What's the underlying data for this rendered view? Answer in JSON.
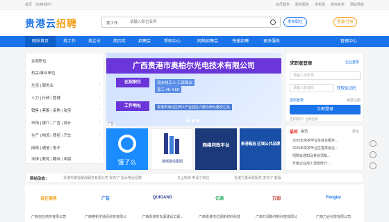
{
  "topbar": {
    "home": "首页",
    "mobile": "[切换城市]",
    "links": [
      "会员服务",
      "政务服务",
      "手机版",
      "微信有奖",
      "网站导航"
    ]
  },
  "header": {
    "logo_main": "贵港云",
    "logo_accent": "招聘",
    "search_type": "找工作",
    "search_placeholder": "请输入职位名称",
    "post_job": "发布职位",
    "login_register": "登录/注册"
  },
  "nav": {
    "items": [
      "网站首页",
      "找工作",
      "找企业",
      "简历库",
      "招聘会",
      "帮助中心",
      "网络招聘会",
      "快速招聘",
      "更多服务"
    ],
    "manage": "管理中心"
  },
  "categories": {
    "heading": "全部职位",
    "items": [
      "机关/事业单位",
      "生活 | 服务业",
      "人力 | 行政 | 管理",
      "销售 | 客服 | 采购 | 淘宝",
      "市场 | 媒介 | 广告 | 设计",
      "生产 | 物流 | 质控 | 汽车",
      "网络 | 通信 | 电子",
      "法律 | 教育 | 翻译 | 出版"
    ]
  },
  "banner": {
    "company": "广西贵港市奥柏尔光电技术有限公司",
    "recruit_label": "在招职位",
    "job": "流水线工人  工资面议",
    "salary": "普工  4K-4.5K",
    "addr_label": "工作地址",
    "address": "贵港市港北区西江产业园区六路与西七路交汇处",
    "corner_tag": "广告"
  },
  "tiles": {
    "t1": "饿了么",
    "t2": "莲城建设集团",
    "t3": "网络问政平台",
    "t4": "贵港甄选 区域公共品牌"
  },
  "login": {
    "title": "求职者登录",
    "switch": "企业登录",
    "phone_placeholder": "请输入手机号",
    "code_placeholder": "请输入验证码",
    "get_code": "获取验证码",
    "password_login": "密码登录",
    "register": "免费注册",
    "submit": "立即登录",
    "agree": "还有账号？立即注册"
  },
  "news": {
    "hot": "最新",
    "title": "资讯",
    "more": "更多",
    "items": [
      "2025年高校毕业生就业服务...",
      "2025年高校毕业生春季就业...",
      "招聘会通知及参会须知...",
      "年度企业用工调查统计..."
    ]
  },
  "ticker": {
    "label": "网站动态：",
    "items": [
      "贵港市聚福家政服务有限公司 发布了 投诉电话招聘",
      "马上新鲜 申请了职位",
      "贵港力量保安服务 发布了 客服"
    ]
  },
  "companies": [
    {
      "logo": "自在商务",
      "name": "广西自在商务有限公司",
      "color": "#f39c12"
    },
    {
      "logo": "广告",
      "name": "广西奥帆宇通讯科技有限公司",
      "color": "#1a73e8"
    },
    {
      "logo": "QUIGANG",
      "name": "广西贵港市东源建设工程...",
      "color": "#2c3e8f"
    },
    {
      "logo": "亿源",
      "name": "广西贵港市亿源新材料科技...",
      "color": "#27ae60"
    },
    {
      "logo": "万润",
      "name": "广西万润新材料科技有限公司",
      "color": "#c0392b"
    },
    {
      "logo": "Fengtai",
      "name": "广西力合科技有限公司",
      "color": "#1a73e8"
    }
  ]
}
